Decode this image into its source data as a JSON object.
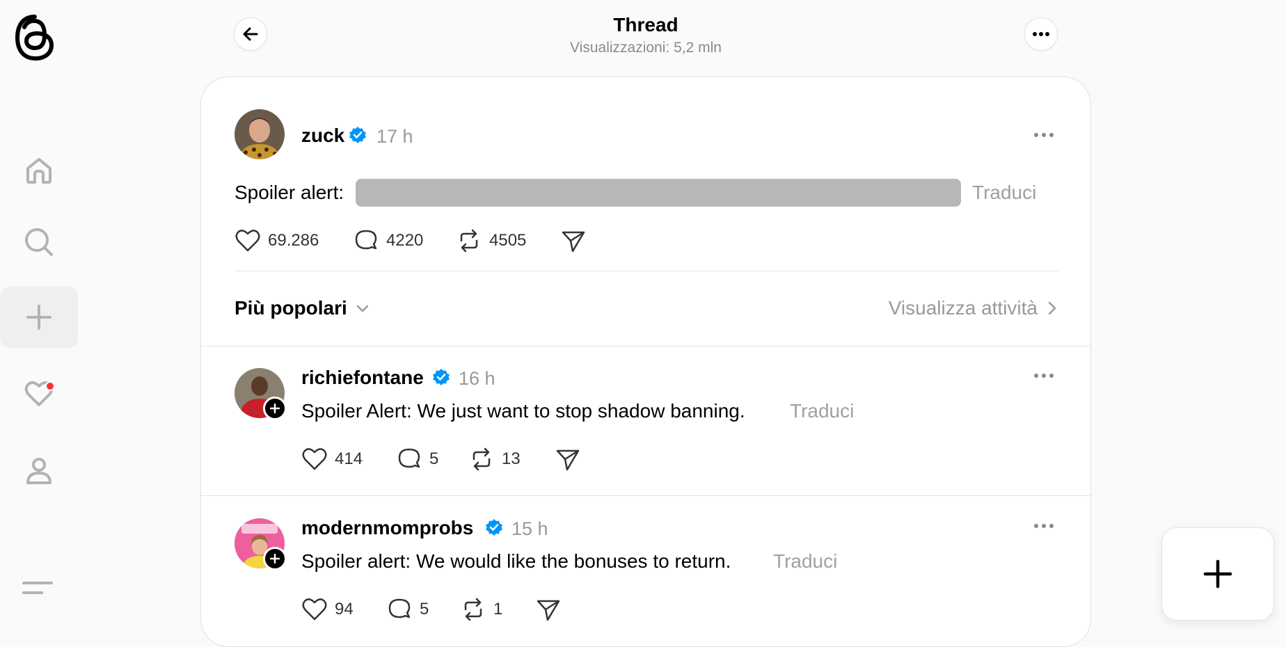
{
  "header": {
    "title": "Thread",
    "subtitle": "Visualizzazioni: 5,2 mln"
  },
  "nav": {
    "items": [
      "home-icon",
      "search-icon",
      "create-icon",
      "activity-icon",
      "profile-icon"
    ],
    "active": "create-icon",
    "notification_color": "#ff3040"
  },
  "main_post": {
    "username": "zuck",
    "time": "17 h",
    "text": "Spoiler alert:",
    "translate": "Traduci",
    "likes": "69.286",
    "replies": "4220",
    "reposts": "4505"
  },
  "sort": {
    "label": "Più popolari",
    "activity_link": "Visualizza attività"
  },
  "replies": [
    {
      "username": "richiefontane",
      "time": "16 h",
      "text": "Spoiler Alert: We just want to stop shadow banning.",
      "translate": "Traduci",
      "likes": "414",
      "replies": "5",
      "reposts": "13"
    },
    {
      "username": "modernmomprobs",
      "time": "15 h",
      "text": "Spoiler alert: We would like the bonuses to return.",
      "translate": "Traduci",
      "likes": "94",
      "replies": "5",
      "reposts": "1"
    }
  ],
  "colors": {
    "verified": "#0095f6",
    "muted": "#999999",
    "background": "#fafafa"
  }
}
